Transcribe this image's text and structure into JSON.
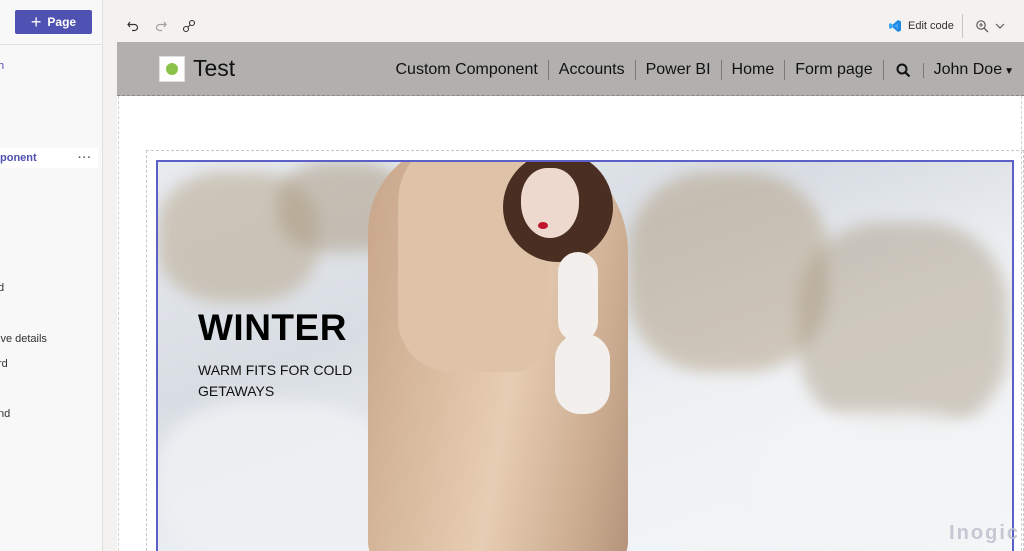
{
  "left_panel": {
    "add_page_label": "Page",
    "link_text": "h",
    "items": [
      {
        "label": "ponent",
        "selected": true
      },
      {
        "label": "d"
      },
      {
        "label": "ive details"
      },
      {
        "label": "rd"
      },
      {
        "label": "nd"
      }
    ]
  },
  "toolbar": {
    "edit_code_label": "Edit code"
  },
  "site": {
    "title": "Test",
    "nav": [
      "Custom Component",
      "Accounts",
      "Power BI",
      "Home",
      "Form page"
    ],
    "user": "John Doe"
  },
  "hero": {
    "title": "WINTER",
    "subtitle": "WARM FITS FOR COLD GETAWAYS"
  },
  "watermark": "Inogic",
  "colors": {
    "accent": "#4f52b2",
    "header_bg": "#b1b0ae",
    "selection_border": "#5b5fc7"
  }
}
